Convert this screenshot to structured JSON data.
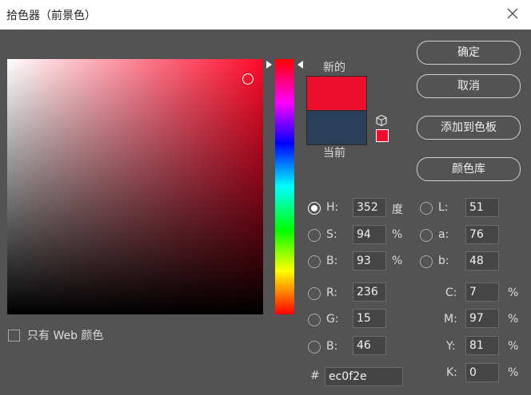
{
  "window": {
    "title": "拾色器（前景色）"
  },
  "preview": {
    "new_label": "新的",
    "current_label": "当前",
    "new_color": "#ec0f2e",
    "current_color": "#293f58"
  },
  "icons": {
    "close": "close-icon",
    "gamut": "cube-icon"
  },
  "buttons": {
    "ok": "确定",
    "cancel": "取消",
    "add_to_swatches": "添加到色板",
    "color_libraries": "颜色库"
  },
  "hsb": {
    "h": {
      "label": "H:",
      "value": "352",
      "unit": "度",
      "checked": true
    },
    "s": {
      "label": "S:",
      "value": "94",
      "unit": "%"
    },
    "b": {
      "label": "B:",
      "value": "93",
      "unit": "%"
    }
  },
  "rgb": {
    "r": {
      "label": "R:",
      "value": "236"
    },
    "g": {
      "label": "G:",
      "value": "15"
    },
    "b": {
      "label": "B:",
      "value": "46"
    }
  },
  "lab": {
    "l": {
      "label": "L:",
      "value": "51"
    },
    "a": {
      "label": "a:",
      "value": "76"
    },
    "b": {
      "label": "b:",
      "value": "48"
    }
  },
  "cmyk": {
    "c": {
      "label": "C:",
      "value": "7",
      "unit": "%"
    },
    "m": {
      "label": "M:",
      "value": "97",
      "unit": "%"
    },
    "y": {
      "label": "Y:",
      "value": "81",
      "unit": "%"
    },
    "k": {
      "label": "K:",
      "value": "0",
      "unit": "%"
    }
  },
  "hex": {
    "label": "#",
    "value": "ec0f2e"
  },
  "web_only": {
    "label": "只有 Web 颜色",
    "checked": false
  }
}
